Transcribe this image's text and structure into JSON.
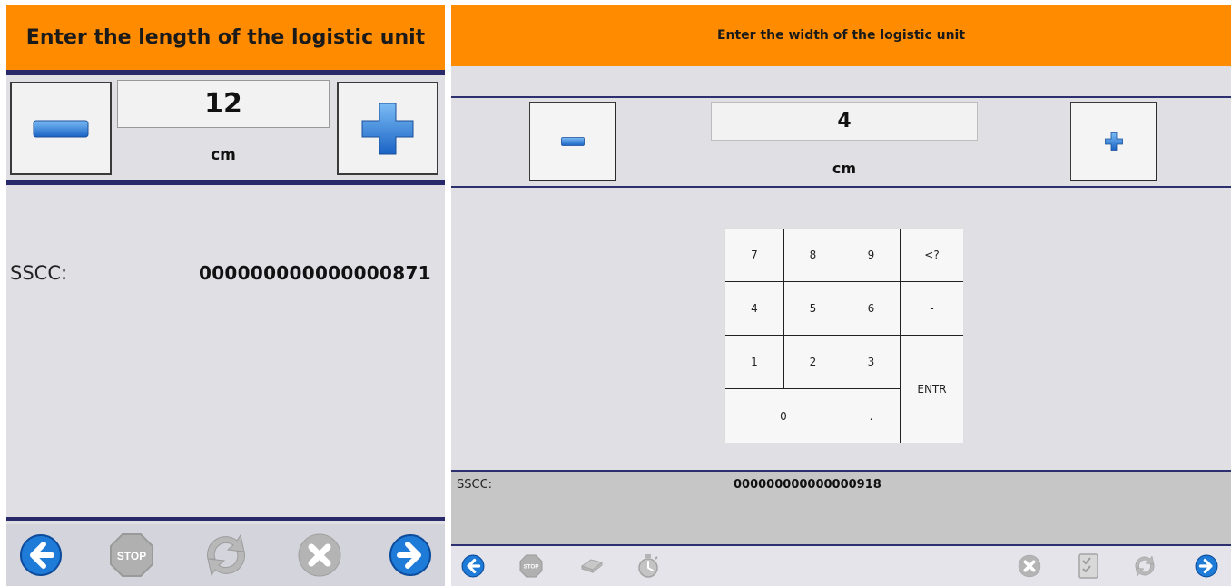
{
  "left": {
    "header": {
      "title": "Enter the length of the logistic unit"
    },
    "stepper": {
      "value": "12",
      "unit": "cm",
      "minus": "minus-icon",
      "plus": "plus-icon"
    },
    "info": {
      "sscc_label": "SSCC:",
      "sscc_value": "000000000000000871"
    },
    "toolbar": {
      "icons": [
        "back-arrow-icon",
        "stop-icon",
        "refresh-icon",
        "cancel-icon",
        "forward-arrow-icon"
      ]
    }
  },
  "right": {
    "header": {
      "title": "Enter the width of the logistic unit"
    },
    "stepper": {
      "value": "4",
      "unit": "cm",
      "minus": "minus-icon",
      "plus": "plus-icon"
    },
    "keypad": {
      "k7": "7",
      "k8": "8",
      "k9": "9",
      "backspace": "<?",
      "k4": "4",
      "k5": "5",
      "k6": "6",
      "minus": "-",
      "k1": "1",
      "k2": "2",
      "k3": "3",
      "enter": "ENTR",
      "k0": "0",
      "dot": "."
    },
    "info": {
      "sscc_label": "SSCC:",
      "sscc_value": "000000000000000918"
    },
    "toolbar": {
      "icons": [
        "back-arrow-icon",
        "stop-icon",
        "eraser-icon",
        "stopwatch-icon",
        "cancel-icon",
        "checklist-icon",
        "refresh-icon",
        "forward-arrow-icon"
      ]
    }
  },
  "colors": {
    "header": "#ff8c00",
    "accent_line": "#27296b",
    "panel_bg": "#e0dfe4",
    "icon_blue": "#1e7bd8",
    "disabled_gray": "#b0b0b0"
  }
}
